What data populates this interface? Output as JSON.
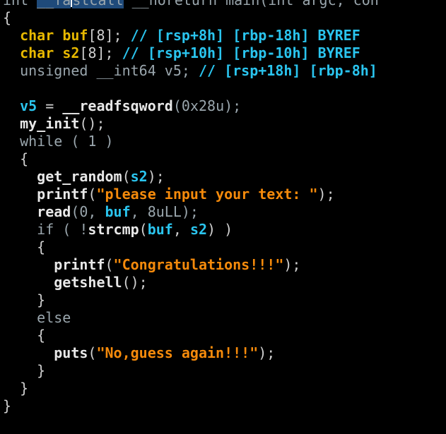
{
  "editor": {
    "lines": [
      [
        {
          "t": "int ",
          "c": "kw"
        },
        {
          "t": "__fa",
          "c": "hl"
        },
        {
          "t": "caret",
          "c": "caret"
        },
        {
          "t": "stcall",
          "c": "hl"
        },
        {
          "t": " __noreturn main(int argc, con",
          "c": "kw"
        }
      ],
      [
        {
          "t": "{",
          "c": "pun"
        }
      ],
      [
        {
          "t": "  ",
          "c": "plain"
        },
        {
          "t": "char",
          "c": "kwb"
        },
        {
          "t": " ",
          "c": "plain"
        },
        {
          "t": "buf",
          "c": "kwb"
        },
        {
          "t": "[8]; ",
          "c": "pun"
        },
        {
          "t": "// [rsp+8h] [rbp-18h] BYREF",
          "c": "cmt"
        }
      ],
      [
        {
          "t": "  ",
          "c": "plain"
        },
        {
          "t": "char",
          "c": "kwb"
        },
        {
          "t": " ",
          "c": "plain"
        },
        {
          "t": "s2",
          "c": "kwb"
        },
        {
          "t": "[8]; ",
          "c": "pun"
        },
        {
          "t": "// [rsp+10h] [rbp-10h] BYREF",
          "c": "cmt"
        }
      ],
      [
        {
          "t": "  unsigned __int64 v5; ",
          "c": "kw"
        },
        {
          "t": "// [rsp+18h] [rbp-8h]",
          "c": "cmt"
        }
      ],
      [
        {
          "t": "",
          "c": "plain"
        }
      ],
      [
        {
          "t": "  ",
          "c": "plain"
        },
        {
          "t": "v5",
          "c": "var"
        },
        {
          "t": " = ",
          "c": "pun"
        },
        {
          "t": "__readfsqword",
          "c": "fn"
        },
        {
          "t": "(0x28u);",
          "c": "num"
        }
      ],
      [
        {
          "t": "  ",
          "c": "plain"
        },
        {
          "t": "my_init",
          "c": "fn"
        },
        {
          "t": "();",
          "c": "pun"
        }
      ],
      [
        {
          "t": "  while ( 1 )",
          "c": "kw"
        }
      ],
      [
        {
          "t": "  {",
          "c": "pun"
        }
      ],
      [
        {
          "t": "    ",
          "c": "plain"
        },
        {
          "t": "get_random",
          "c": "fn"
        },
        {
          "t": "(",
          "c": "pun"
        },
        {
          "t": "s2",
          "c": "var"
        },
        {
          "t": ");",
          "c": "pun"
        }
      ],
      [
        {
          "t": "    ",
          "c": "plain"
        },
        {
          "t": "printf",
          "c": "fn"
        },
        {
          "t": "(",
          "c": "pun"
        },
        {
          "t": "\"please input your text: \"",
          "c": "str"
        },
        {
          "t": ");",
          "c": "pun"
        }
      ],
      [
        {
          "t": "    ",
          "c": "plain"
        },
        {
          "t": "read",
          "c": "fn"
        },
        {
          "t": "(0, ",
          "c": "num"
        },
        {
          "t": "buf",
          "c": "var"
        },
        {
          "t": ", 8uLL);",
          "c": "num"
        }
      ],
      [
        {
          "t": "    if ( !",
          "c": "kw"
        },
        {
          "t": "strcmp",
          "c": "fn"
        },
        {
          "t": "(",
          "c": "pun"
        },
        {
          "t": "buf",
          "c": "var"
        },
        {
          "t": ", ",
          "c": "pun"
        },
        {
          "t": "s2",
          "c": "var"
        },
        {
          "t": ") )",
          "c": "pun"
        }
      ],
      [
        {
          "t": "    {",
          "c": "pun"
        }
      ],
      [
        {
          "t": "      ",
          "c": "plain"
        },
        {
          "t": "printf",
          "c": "fn"
        },
        {
          "t": "(",
          "c": "pun"
        },
        {
          "t": "\"Congratulations!!!\"",
          "c": "str"
        },
        {
          "t": ");",
          "c": "pun"
        }
      ],
      [
        {
          "t": "      ",
          "c": "plain"
        },
        {
          "t": "getshell",
          "c": "fn"
        },
        {
          "t": "();",
          "c": "pun"
        }
      ],
      [
        {
          "t": "    }",
          "c": "pun"
        }
      ],
      [
        {
          "t": "    else",
          "c": "kw"
        }
      ],
      [
        {
          "t": "    {",
          "c": "pun"
        }
      ],
      [
        {
          "t": "      ",
          "c": "plain"
        },
        {
          "t": "puts",
          "c": "fn"
        },
        {
          "t": "(",
          "c": "pun"
        },
        {
          "t": "\"No,guess again!!!\"",
          "c": "str"
        },
        {
          "t": ");",
          "c": "pun"
        }
      ],
      [
        {
          "t": "    }",
          "c": "pun"
        }
      ],
      [
        {
          "t": "  }",
          "c": "pun"
        }
      ],
      [
        {
          "t": "}",
          "c": "pun"
        }
      ]
    ]
  },
  "colors": {
    "background": "#000000",
    "keyword_gray": "#9aa6ad",
    "type_yellow": "#e7b800",
    "variable_cyan": "#2ac4ee",
    "string_orange": "#f58a0b",
    "function_white": "#e8e8e8",
    "selection_blue": "#1f4a7a"
  }
}
